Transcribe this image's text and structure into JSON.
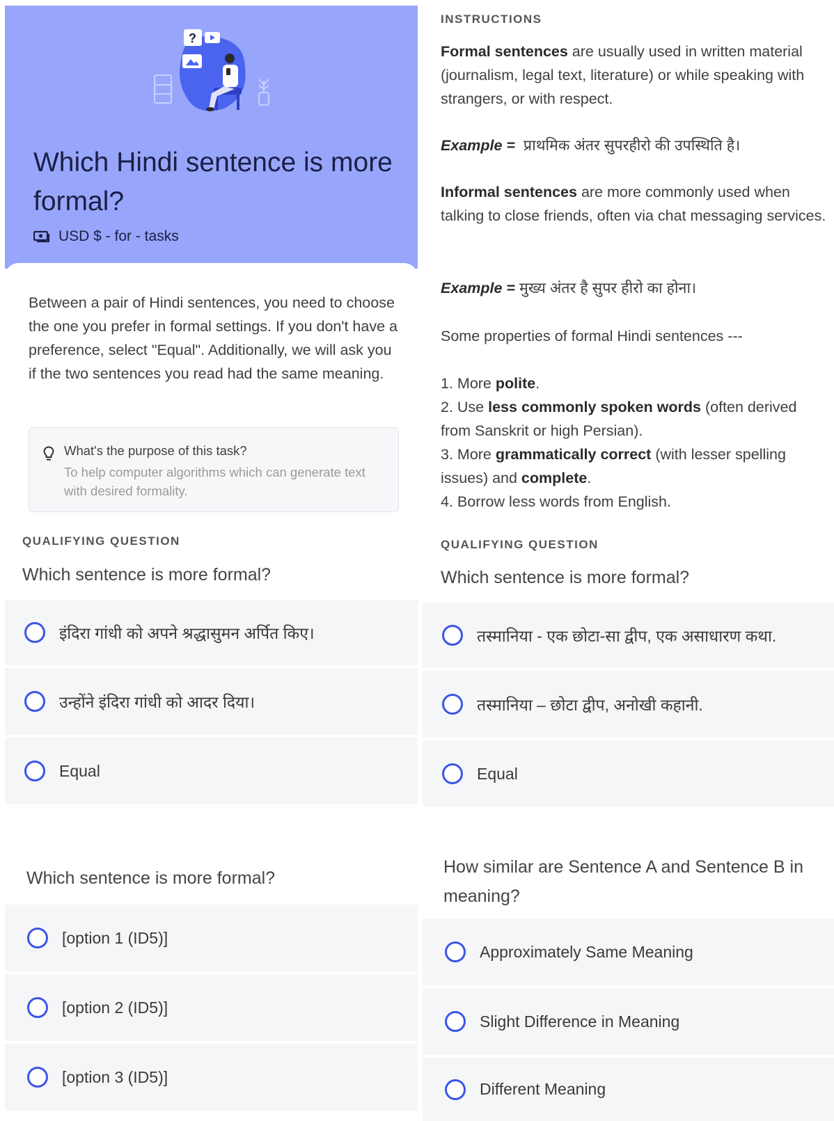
{
  "header": {
    "title": "Which Hindi sentence is more formal?",
    "pay_text": "USD $ - for - tasks",
    "colors": {
      "header_bg": "#97a6fb",
      "title": "#1a1f44",
      "radio": "#3b55e6"
    }
  },
  "intro": {
    "description": "Between a pair of Hindi sentences, you need to choose the one you prefer in formal settings. If you don't have a preference, select \"Equal\". Additionally, we will ask you if the two sentences you read had the same meaning.",
    "purpose_question": "What's the purpose of this task?",
    "purpose_answer": "To help computer algorithms which can generate text with desired formality."
  },
  "left_q1": {
    "section_label": "QUALIFYING QUESTION",
    "question": "Which sentence is more formal?",
    "options": [
      "इंदिरा गांधी को अपने श्रद्धासुमन अर्पित किए।",
      "उन्होंने इंदिरा गांधी को आदर दिया।",
      "Equal"
    ]
  },
  "left_q2": {
    "question": "Which sentence is more formal?",
    "options": [
      "[option 1 (ID5)]",
      "[option 2 (ID5)]",
      "[option 3 (ID5)]"
    ]
  },
  "instructions": {
    "label": "INSTRUCTIONS",
    "formal_bold": "Formal sentences",
    "formal_rest": " are usually used in written material (journalism, legal text, literature) or while speaking with strangers, or with respect.",
    "example_label": "Example =",
    "formal_example": "प्राथमिक अंतर सुपरहीरो की उपस्थिति है।",
    "informal_bold": "Informal sentences",
    "informal_rest": " are more commonly used when talking to close friends, often via chat messaging services.",
    "informal_example": "मुख्य अंतर है सुपर हीरो का होना।",
    "properties_intro": "Some properties of formal Hindi sentences ---",
    "p1_a": "1. More ",
    "p1_b": "polite",
    "p1_c": ".",
    "p2_a": "2. Use ",
    "p2_b": "less commonly spoken words",
    "p2_c": " (often derived from Sanskrit or high Persian).",
    "p3_a": "3. More ",
    "p3_b": "grammatically correct",
    "p3_c": " (with lesser spelling issues) and ",
    "p3_d": "complete",
    "p3_e": ".",
    "p4": "4. Borrow less words from English."
  },
  "right_q1": {
    "section_label": "QUALIFYING QUESTION",
    "question": "Which sentence is more formal?",
    "options": [
      "तस्मानिया - एक छोटा-सा द्वीप, एक असाधारण कथा.",
      "तस्मानिया – छोटा द्वीप, अनोखी कहानी.",
      "Equal"
    ]
  },
  "right_q2": {
    "question": "How similar are Sentence A and Sentence B in meaning?",
    "options": [
      "Approximately Same Meaning",
      "Slight Difference in Meaning",
      "Different Meaning"
    ]
  }
}
